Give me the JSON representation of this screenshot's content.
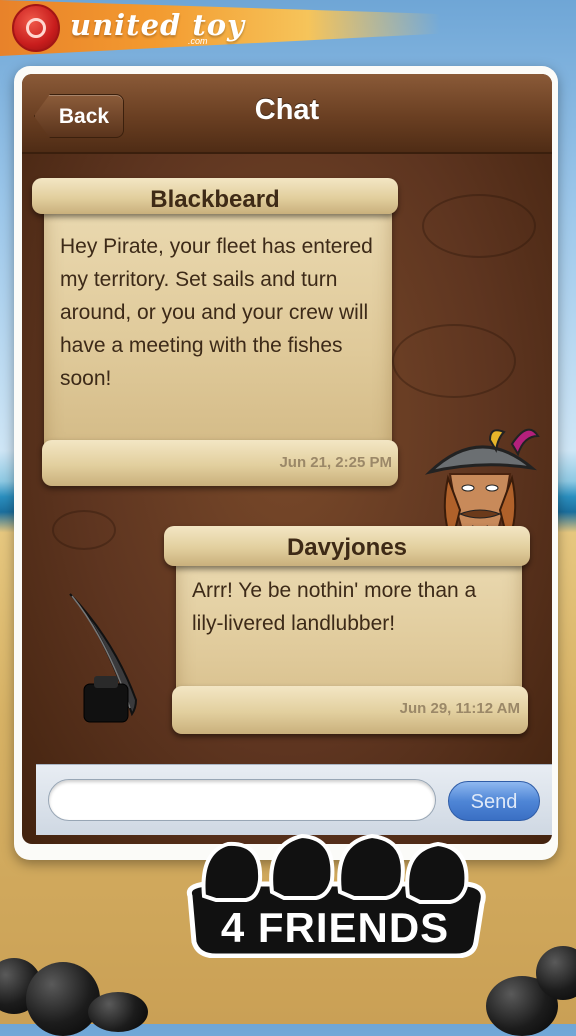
{
  "banner": {
    "brand": "united toy",
    "brand_sub": ".com"
  },
  "nav": {
    "back_label": "Back",
    "title": "Chat"
  },
  "messages": [
    {
      "sender": "Blackbeard",
      "text": "Hey Pirate, your fleet has entered my territory. Set sails and turn around, or you and your crew will have a meeting with the fishes soon!",
      "time": "Jun 21,  2:25 PM"
    },
    {
      "sender": "Davyjones",
      "text": "Arrr! Ye be nothin' more than a lily-livered landlubber!",
      "time": "Jun 29,  11:12 AM"
    }
  ],
  "composer": {
    "placeholder": "",
    "send_label": "Send"
  },
  "promo": {
    "label": "4 FRIENDS"
  },
  "icons": {
    "pirate": "pirate-avatar-icon",
    "quill": "quill-inkwell-icon",
    "seal": "wax-seal-logo-icon"
  },
  "colors": {
    "panel": "#5e3520",
    "paper": "#e2cf9e",
    "send": "#4f86d6"
  }
}
